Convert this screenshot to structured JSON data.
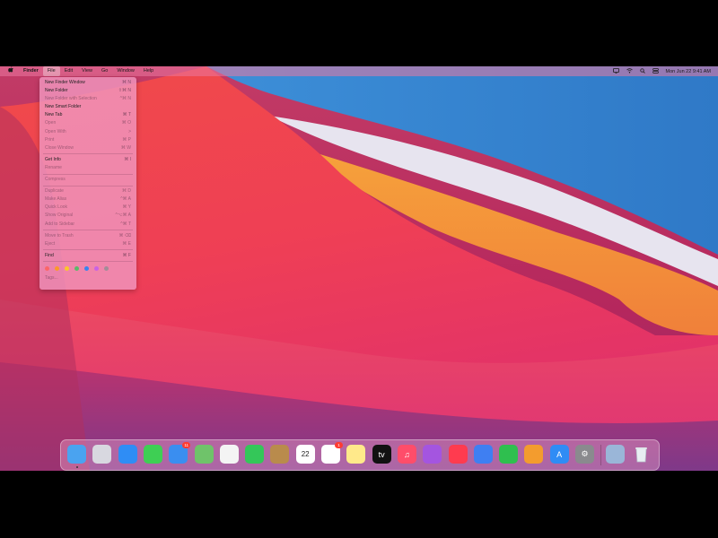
{
  "menubar": {
    "apple": "",
    "app_name": "Finder",
    "menus": [
      "File",
      "Edit",
      "View",
      "Go",
      "Window",
      "Help"
    ],
    "clock": "Mon Jun 22  9:41 AM"
  },
  "file_menu": {
    "groups": [
      [
        {
          "label": "New Finder Window",
          "shortcut": "⌘ N",
          "enabled": true
        },
        {
          "label": "New Folder",
          "shortcut": "⇧⌘ N",
          "enabled": true
        },
        {
          "label": "New Folder with Selection",
          "shortcut": "^⌘ N",
          "enabled": false
        },
        {
          "label": "New Smart Folder",
          "shortcut": "",
          "enabled": true
        },
        {
          "label": "New Tab",
          "shortcut": "⌘ T",
          "enabled": true
        },
        {
          "label": "Open",
          "shortcut": "⌘ O",
          "enabled": false
        },
        {
          "label": "Open With",
          "shortcut": ">",
          "enabled": false
        },
        {
          "label": "Print",
          "shortcut": "⌘ P",
          "enabled": false
        },
        {
          "label": "Close Window",
          "shortcut": "⌘ W",
          "enabled": false
        }
      ],
      [
        {
          "label": "Get Info",
          "shortcut": "⌘ I",
          "enabled": true
        },
        {
          "label": "Rename",
          "shortcut": "",
          "enabled": false
        }
      ],
      [
        {
          "label": "Compress",
          "shortcut": "",
          "enabled": false
        }
      ],
      [
        {
          "label": "Duplicate",
          "shortcut": "⌘ D",
          "enabled": false
        },
        {
          "label": "Make Alias",
          "shortcut": "^⌘ A",
          "enabled": false
        },
        {
          "label": "Quick Look",
          "shortcut": "⌘ Y",
          "enabled": false
        },
        {
          "label": "Show Original",
          "shortcut": "^⌥⌘ A",
          "enabled": false
        },
        {
          "label": "Add to Sidebar",
          "shortcut": "^⌘ T",
          "enabled": false
        }
      ],
      [
        {
          "label": "Move to Trash",
          "shortcut": "⌘ ⌫",
          "enabled": false
        },
        {
          "label": "Eject",
          "shortcut": "⌘ E",
          "enabled": false
        }
      ],
      [
        {
          "label": "Find",
          "shortcut": "⌘ F",
          "enabled": true
        }
      ]
    ],
    "tag_colors": [
      "#ff5f57",
      "#ff9f0a",
      "#ffd60a",
      "#34c759",
      "#0a84ff",
      "#bf5af2",
      "#8e8e93"
    ],
    "tags_label": "Tags..."
  },
  "dock": {
    "apps": [
      {
        "name": "finder",
        "color": "#4aa3f0",
        "glyph": "",
        "running": true,
        "badge": ""
      },
      {
        "name": "launchpad",
        "color": "#d8d8e0",
        "glyph": "",
        "running": false,
        "badge": ""
      },
      {
        "name": "safari",
        "color": "#2f8df5",
        "glyph": "",
        "running": false,
        "badge": ""
      },
      {
        "name": "messages",
        "color": "#3ecf54",
        "glyph": "",
        "running": false,
        "badge": ""
      },
      {
        "name": "mail",
        "color": "#3a8ef0",
        "glyph": "",
        "running": false,
        "badge": "11"
      },
      {
        "name": "maps",
        "color": "#6fc36a",
        "glyph": "",
        "running": false,
        "badge": ""
      },
      {
        "name": "photos",
        "color": "#f4f4f4",
        "glyph": "",
        "running": false,
        "badge": ""
      },
      {
        "name": "facetime",
        "color": "#34c759",
        "glyph": "",
        "running": false,
        "badge": ""
      },
      {
        "name": "contacts",
        "color": "#b98b4c",
        "glyph": "",
        "running": false,
        "badge": ""
      },
      {
        "name": "calendar",
        "color": "#ffffff",
        "glyph": "22",
        "running": false,
        "badge": ""
      },
      {
        "name": "reminders",
        "color": "#ffffff",
        "glyph": "",
        "running": false,
        "badge": "1"
      },
      {
        "name": "notes",
        "color": "#ffe98a",
        "glyph": "",
        "running": false,
        "badge": ""
      },
      {
        "name": "apple-tv",
        "color": "#111111",
        "glyph": "tv",
        "running": false,
        "badge": ""
      },
      {
        "name": "music",
        "color": "#ff4d6a",
        "glyph": "♫",
        "running": false,
        "badge": ""
      },
      {
        "name": "podcasts",
        "color": "#a455e0",
        "glyph": "",
        "running": false,
        "badge": ""
      },
      {
        "name": "news",
        "color": "#ff3b4f",
        "glyph": "",
        "running": false,
        "badge": ""
      },
      {
        "name": "keynote",
        "color": "#3f7ff2",
        "glyph": "",
        "running": false,
        "badge": ""
      },
      {
        "name": "numbers",
        "color": "#2fbf4f",
        "glyph": "",
        "running": false,
        "badge": ""
      },
      {
        "name": "pages",
        "color": "#f39c2e",
        "glyph": "",
        "running": false,
        "badge": ""
      },
      {
        "name": "app-store",
        "color": "#2f8cf5",
        "glyph": "A",
        "running": false,
        "badge": ""
      },
      {
        "name": "system-preferences",
        "color": "#8a8a8e",
        "glyph": "⚙",
        "running": false,
        "badge": ""
      },
      {
        "name": "preview",
        "color": "#9ab6d8",
        "glyph": "",
        "running": false,
        "badge": ""
      },
      {
        "name": "trash",
        "color": "#e8eef2",
        "glyph": "",
        "running": false,
        "badge": ""
      }
    ]
  }
}
